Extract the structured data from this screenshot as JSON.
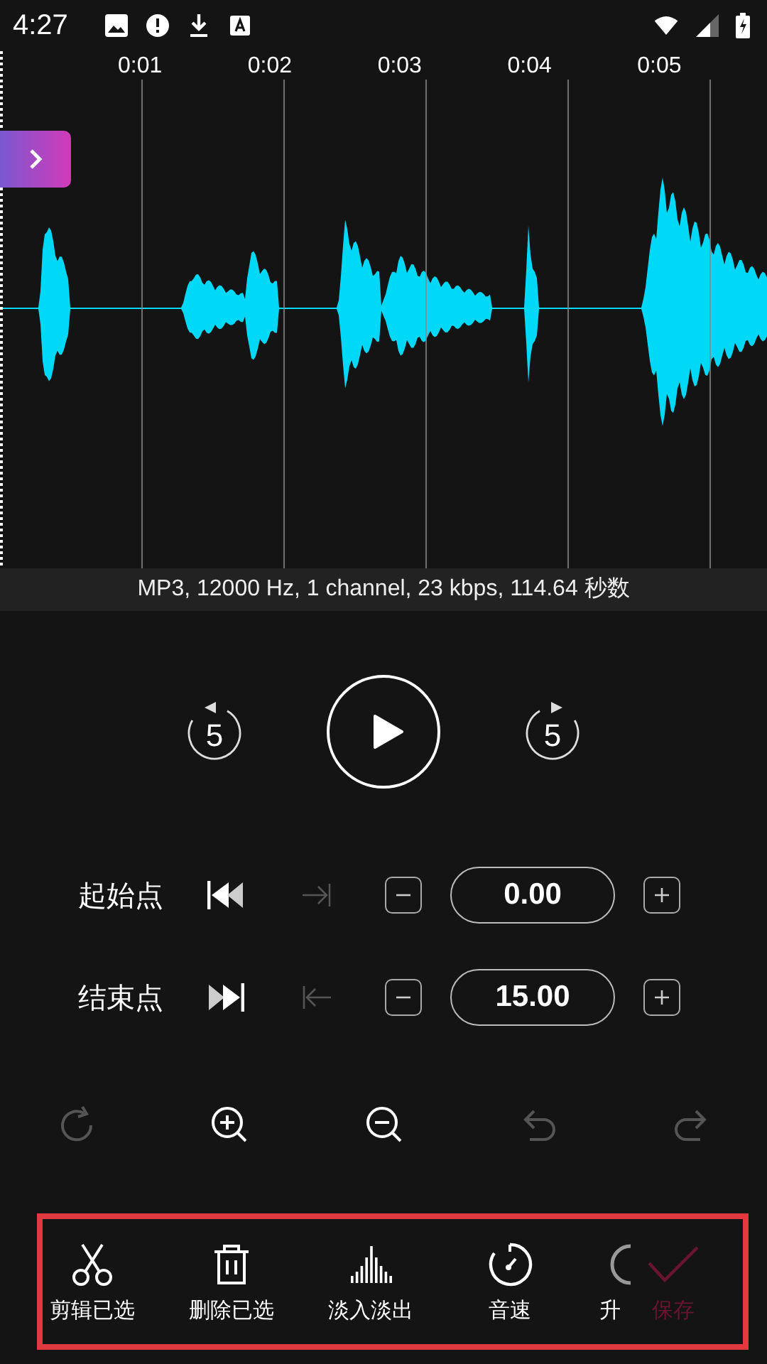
{
  "status_bar": {
    "time": "4:27"
  },
  "timeline": {
    "ticks": [
      "0:01",
      "0:02",
      "0:03",
      "0:04",
      "0:05"
    ]
  },
  "file_info": "MP3, 12000 Hz, 1 channel, 23 kbps, 114.64 秒数",
  "playback": {
    "back_seconds": "5",
    "forward_seconds": "5"
  },
  "markers": [
    {
      "label": "起始点",
      "value": "0.00",
      "set_disabled": true
    },
    {
      "label": "结束点",
      "value": "15.00",
      "set_disabled": true
    }
  ],
  "edit_tools": [
    {
      "disabled": true
    },
    {
      "disabled": false
    },
    {
      "disabled": false
    },
    {
      "disabled": true
    },
    {
      "disabled": true
    }
  ],
  "toolbar": {
    "tools": [
      {
        "label": "剪辑已选"
      },
      {
        "label": "删除已选"
      },
      {
        "label": "淡入淡出"
      },
      {
        "label": "音速"
      },
      {
        "label": "升"
      }
    ],
    "save": {
      "label": "保存",
      "disabled": true
    }
  }
}
